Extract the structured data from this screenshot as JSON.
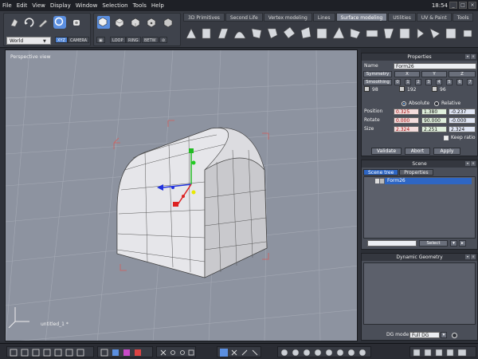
{
  "menu": [
    "File",
    "Edit",
    "View",
    "Display",
    "Window",
    "Selection",
    "Tools",
    "Help"
  ],
  "clock": "18:54",
  "window_buttons": [
    "_",
    "□",
    "×"
  ],
  "toolbar": {
    "coord_space": "World",
    "mode_buttons": [
      "XYZ",
      "CAMERA"
    ],
    "selection_modes": [
      "LOOP",
      "RING",
      "BETW"
    ],
    "tabs": [
      "3D Primitives",
      "Second Life",
      "Vertex modeling",
      "Lines",
      "Surface modeling",
      "Utilities",
      "UV & Paint",
      "Tools"
    ],
    "active_tab": "Surface modeling"
  },
  "viewport": {
    "label": "Perspective view",
    "scene_name": "untitled_1 *"
  },
  "properties": {
    "title": "Properties",
    "name_label": "Name",
    "name_value": "Form26",
    "symmetry_label": "Symmetry",
    "axes": [
      "X",
      "Y",
      "Z"
    ],
    "smoothing_label": "Smoothing",
    "smoothing_levels": [
      "0",
      "1",
      "2",
      "3",
      "4",
      "5",
      "6",
      "7"
    ],
    "color_values": [
      "98",
      "192",
      "96"
    ],
    "absolute_label": "Absolute",
    "relative_label": "Relative",
    "position_label": "Position",
    "position": [
      "0.325",
      "1.380",
      "-0.237"
    ],
    "rotate_label": "Rotate",
    "rotate": [
      "0.000",
      "90.000",
      "-0.000"
    ],
    "size_label": "Size",
    "size": [
      "2.324",
      "2.251",
      "2.324"
    ],
    "keep_ratio_label": "Keep ratio",
    "validate_label": "Validate",
    "abort_label": "Abort",
    "apply_label": "Apply"
  },
  "scene": {
    "title": "Scene",
    "tab_tree": "Scene tree",
    "tab_properties": "Properties",
    "items": [
      "Form26"
    ],
    "select_label": "Select"
  },
  "dynamic_geometry": {
    "title": "Dynamic Geometry",
    "mode_label": "DG mode:",
    "mode_value": "Full DG"
  }
}
